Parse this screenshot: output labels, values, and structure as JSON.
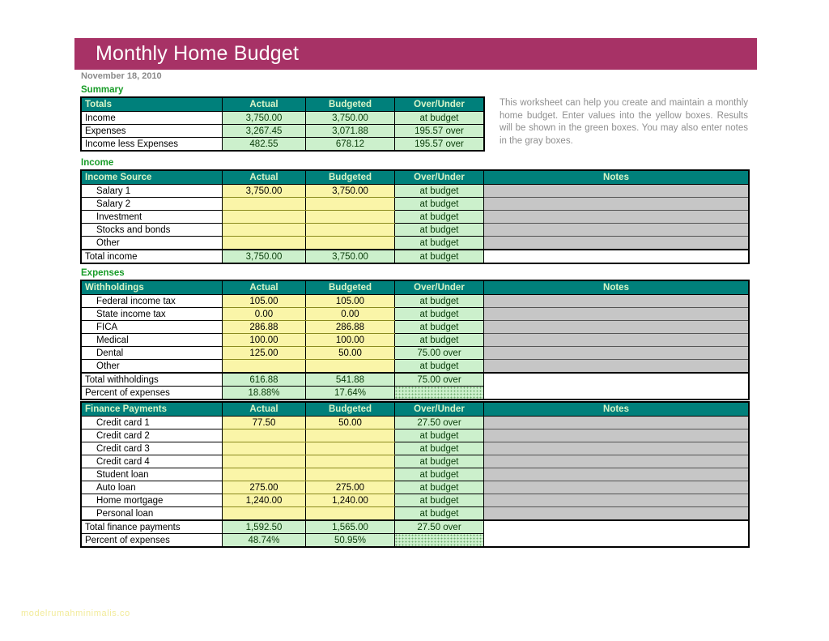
{
  "header": {
    "title": "Monthly Home Budget",
    "date": "November 18, 2010",
    "bar_color": "#a73266"
  },
  "intro": {
    "text": "This worksheet can help you create and maintain a monthly home budget. Enter values into the yellow boxes. Results will be shown in the green boxes. You may also enter notes in the gray boxes."
  },
  "columns": {
    "actual": "Actual",
    "budgeted": "Budgeted",
    "over_under": "Over/Under",
    "notes": "Notes"
  },
  "sections": {
    "summary": {
      "caption": "Summary",
      "header_label": "Totals",
      "rows": [
        {
          "label": "Income",
          "actual": "3,750.00",
          "budgeted": "3,750.00",
          "over_under": "at budget"
        },
        {
          "label": "Expenses",
          "actual": "3,267.45",
          "budgeted": "3,071.88",
          "over_under": "195.57 over"
        },
        {
          "label": "Income less Expenses",
          "actual": "482.55",
          "budgeted": "678.12",
          "over_under": "195.57 over"
        }
      ]
    },
    "income": {
      "caption": "Income",
      "header_label": "Income Source",
      "rows": [
        {
          "label": "Salary 1",
          "actual": "3,750.00",
          "budgeted": "3,750.00",
          "over_under": "at budget"
        },
        {
          "label": "Salary 2",
          "actual": "",
          "budgeted": "",
          "over_under": "at budget"
        },
        {
          "label": "Investment",
          "actual": "",
          "budgeted": "",
          "over_under": "at budget"
        },
        {
          "label": "Stocks and bonds",
          "actual": "",
          "budgeted": "",
          "over_under": "at budget"
        },
        {
          "label": "Other",
          "actual": "",
          "budgeted": "",
          "over_under": "at budget"
        }
      ],
      "total": {
        "label": "Total income",
        "actual": "3,750.00",
        "budgeted": "3,750.00",
        "over_under": "at budget"
      }
    },
    "expenses": {
      "caption": "Expenses"
    },
    "withholdings": {
      "header_label": "Withholdings",
      "rows": [
        {
          "label": "Federal income tax",
          "actual": "105.00",
          "budgeted": "105.00",
          "over_under": "at budget"
        },
        {
          "label": "State income tax",
          "actual": "0.00",
          "budgeted": "0.00",
          "over_under": "at budget"
        },
        {
          "label": "FICA",
          "actual": "286.88",
          "budgeted": "286.88",
          "over_under": "at budget"
        },
        {
          "label": "Medical",
          "actual": "100.00",
          "budgeted": "100.00",
          "over_under": "at budget"
        },
        {
          "label": "Dental",
          "actual": "125.00",
          "budgeted": "50.00",
          "over_under": "75.00 over"
        },
        {
          "label": "Other",
          "actual": "",
          "budgeted": "",
          "over_under": "at budget"
        }
      ],
      "total": {
        "label": "Total withholdings",
        "actual": "616.88",
        "budgeted": "541.88",
        "over_under": "75.00 over"
      },
      "percent": {
        "label": "Percent of expenses",
        "actual": "18.88%",
        "budgeted": "17.64%"
      }
    },
    "finance": {
      "header_label": "Finance Payments",
      "rows": [
        {
          "label": "Credit card 1",
          "actual": "77.50",
          "budgeted": "50.00",
          "over_under": "27.50 over"
        },
        {
          "label": "Credit card 2",
          "actual": "",
          "budgeted": "",
          "over_under": "at budget"
        },
        {
          "label": "Credit card 3",
          "actual": "",
          "budgeted": "",
          "over_under": "at budget"
        },
        {
          "label": "Credit card 4",
          "actual": "",
          "budgeted": "",
          "over_under": "at budget"
        },
        {
          "label": "Student loan",
          "actual": "",
          "budgeted": "",
          "over_under": "at budget"
        },
        {
          "label": "Auto loan",
          "actual": "275.00",
          "budgeted": "275.00",
          "over_under": "at budget"
        },
        {
          "label": "Home mortgage",
          "actual": "1,240.00",
          "budgeted": "1,240.00",
          "over_under": "at budget"
        },
        {
          "label": "Personal loan",
          "actual": "",
          "budgeted": "",
          "over_under": "at budget"
        }
      ],
      "total": {
        "label": "Total finance payments",
        "actual": "1,592.50",
        "budgeted": "1,565.00",
        "over_under": "27.50 over"
      },
      "percent": {
        "label": "Percent of expenses",
        "actual": "48.74%",
        "budgeted": "50.95%"
      }
    }
  },
  "watermark": {
    "text": "modelrumahminimalis.co"
  }
}
